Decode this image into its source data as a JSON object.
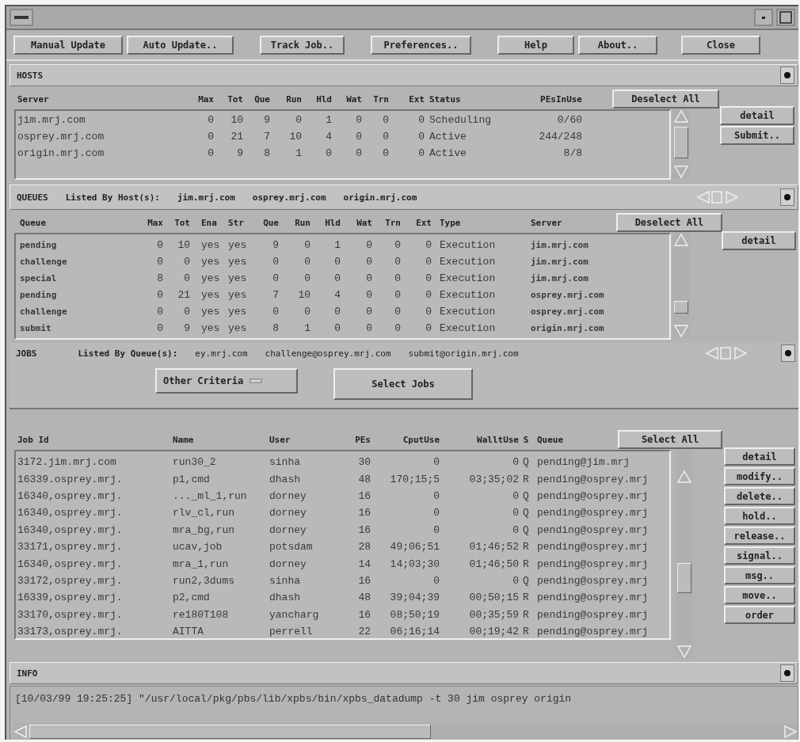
{
  "toolbar": {
    "buttons": [
      "Manual Update",
      "Auto Update..",
      "Track Job..",
      "Preferences..",
      "Help",
      "About..",
      "Close"
    ]
  },
  "hosts": {
    "title": "HOSTS",
    "columns": [
      "Server",
      "Max",
      "Tot",
      "Que",
      "Run",
      "Hld",
      "Wat",
      "Trn",
      "Ext",
      "Status",
      "PEsInUse"
    ],
    "deselect_button": "Deselect All",
    "rows": [
      [
        "jim.mrj.com",
        "0",
        "10",
        "9",
        "0",
        "1",
        "0",
        "0",
        "0",
        "Scheduling",
        "0/60"
      ],
      [
        "osprey.mrj.com",
        "0",
        "21",
        "7",
        "10",
        "4",
        "0",
        "0",
        "0",
        "Active",
        "244/248"
      ],
      [
        "origin.mrj.com",
        "0",
        "9",
        "8",
        "1",
        "0",
        "0",
        "0",
        "0",
        "Active",
        "8/8"
      ]
    ],
    "buttons": [
      "detail",
      "Submit.."
    ]
  },
  "queues": {
    "title": "QUEUES",
    "listed_by_label": "Listed By Host(s):",
    "listed_by": [
      "jim.mrj.com",
      "osprey.mrj.com",
      "origin.mrj.com"
    ],
    "columns": [
      "Queue",
      "Max",
      "Tot",
      "Ena",
      "Str",
      "Que",
      "Run",
      "Hld",
      "Wat",
      "Trn",
      "Ext",
      "Type",
      "Server"
    ],
    "deselect_button": "Deselect All",
    "rows": [
      [
        "pending",
        "0",
        "10",
        "yes",
        "yes",
        "9",
        "0",
        "1",
        "0",
        "0",
        "0",
        "Execution",
        "jim.mrj.com"
      ],
      [
        "challenge",
        "0",
        "0",
        "yes",
        "yes",
        "0",
        "0",
        "0",
        "0",
        "0",
        "0",
        "Execution",
        "jim.mrj.com"
      ],
      [
        "special",
        "8",
        "0",
        "yes",
        "yes",
        "0",
        "0",
        "0",
        "0",
        "0",
        "0",
        "Execution",
        "jim.mrj.com"
      ],
      [
        "pending",
        "0",
        "21",
        "yes",
        "yes",
        "7",
        "10",
        "4",
        "0",
        "0",
        "0",
        "Execution",
        "osprey.mrj.com"
      ],
      [
        "challenge",
        "0",
        "0",
        "yes",
        "yes",
        "0",
        "0",
        "0",
        "0",
        "0",
        "0",
        "Execution",
        "osprey.mrj.com"
      ],
      [
        "submit",
        "0",
        "9",
        "yes",
        "yes",
        "8",
        "1",
        "0",
        "0",
        "0",
        "0",
        "Execution",
        "origin.mrj.com"
      ]
    ],
    "buttons": [
      "detail"
    ]
  },
  "jobs": {
    "title": "JOBS",
    "listed_by_label": "Listed By Queue(s):",
    "listed_by": [
      "ey.mrj.com",
      "challenge@osprey.mrj.com",
      "submit@origin.mrj.com"
    ],
    "criteria_menu": "Other Criteria",
    "select_jobs_button": "Select Jobs",
    "columns": [
      "Job Id",
      "Name",
      "User",
      "PEs",
      "CputUse",
      "WalltUse",
      "S",
      "Queue"
    ],
    "select_all_button": "Select All",
    "rows": [
      [
        "3172.jim.mrj.com",
        "run30_2",
        "sinha",
        "30",
        "0",
        "0",
        "Q",
        "pending@jim.mrj"
      ],
      [
        "16339.osprey.mrj.",
        "p1,cmd",
        "dhash",
        "48",
        "170;15;5",
        "03;35;02",
        "R",
        "pending@osprey.mrj"
      ],
      [
        "16340,osprey.mrj.",
        "..._ml_1,run",
        "dorney",
        "16",
        "0",
        "0",
        "Q",
        "pending@osprey.mrj"
      ],
      [
        "16340,osprey.mrj.",
        "rlv_cl,run",
        "dorney",
        "16",
        "0",
        "0",
        "Q",
        "pending@osprey.mrj"
      ],
      [
        "16340,osprey.mrj.",
        "mra_bg,run",
        "dorney",
        "16",
        "0",
        "0",
        "Q",
        "pending@osprey.mrj"
      ],
      [
        "33171,osprey.mrj.",
        "ucav,job",
        "potsdam",
        "28",
        "49;06;51",
        "01;46;52",
        "R",
        "pending@osprey.mrj"
      ],
      [
        "16340,osprey.mrj.",
        "mra_1,run",
        "dorney",
        "14",
        "14;03;30",
        "01;46;50",
        "R",
        "pending@osprey.mrj"
      ],
      [
        "33172,osprey.mrj.",
        "run2,3dums",
        "sinha",
        "16",
        "0",
        "0",
        "Q",
        "pending@osprey.mrj"
      ],
      [
        "16339,osprey.mrj.",
        "p2,cmd",
        "dhash",
        "48",
        "39;04;39",
        "00;50;15",
        "R",
        "pending@osprey.mrj"
      ],
      [
        "33170,osprey.mrj.",
        "re180T108",
        "yancharg",
        "16",
        "08;50;19",
        "00;35;59",
        "R",
        "pending@osprey.mrj"
      ],
      [
        "33173,osprey.mrj.",
        "AITTA",
        "perrell",
        "22",
        "06;16;14",
        "00;19;42",
        "R",
        "pending@osprey.mrj"
      ]
    ],
    "buttons": [
      "detail",
      "modify..",
      "delete..",
      "hold..",
      "release..",
      "signal..",
      "msg..",
      "move..",
      "order"
    ]
  },
  "info": {
    "title": "INFO",
    "log": "[10/03/99 19:25:25] \"/usr/local/pkg/pbs/lib/xpbs/bin/xpbs_datadump -t 30 jim osprey origin"
  }
}
